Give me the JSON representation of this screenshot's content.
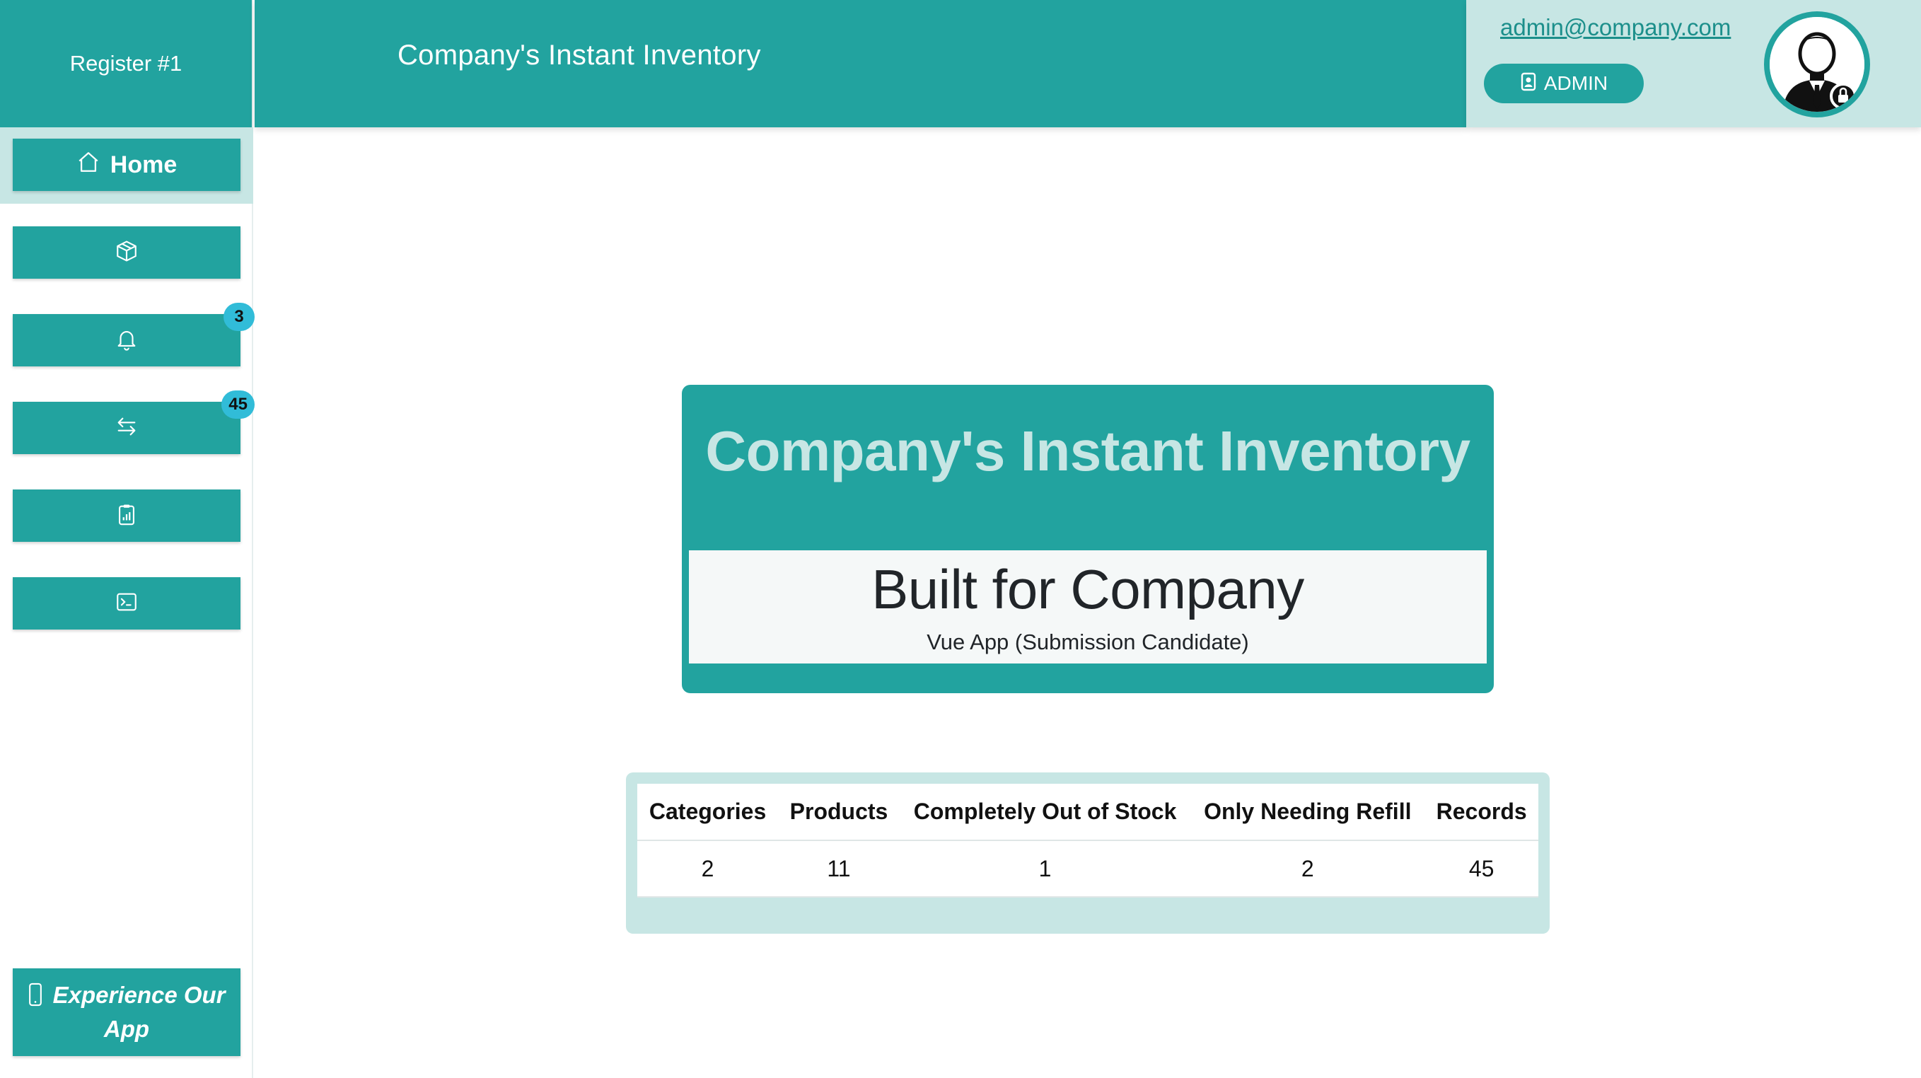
{
  "brand": {
    "register_label": "Register #1"
  },
  "header": {
    "title": "Company's Instant Inventory"
  },
  "user": {
    "email": "admin@company.com",
    "role": "ADMIN"
  },
  "sidebar": {
    "items": [
      {
        "label": "Home",
        "icon": "home-icon"
      },
      {
        "label": "",
        "icon": "box-icon"
      },
      {
        "label": "",
        "icon": "bell-icon",
        "badge": "3"
      },
      {
        "label": "",
        "icon": "transfer-arrows-icon",
        "badge": "45"
      },
      {
        "label": "",
        "icon": "report-clipboard-icon"
      },
      {
        "label": "",
        "icon": "terminal-icon"
      }
    ],
    "app_cta": {
      "label": "Experience Our App",
      "icon": "mobile-phone-icon"
    }
  },
  "hero": {
    "title": "Company's Instant Inventory",
    "subtitle": "Built for Company",
    "note": "Vue App (Submission Candidate)"
  },
  "stats": {
    "headers": [
      "Categories",
      "Products",
      "Completely Out of Stock",
      "Only Needing Refill",
      "Records"
    ],
    "values": [
      "2",
      "11",
      "1",
      "2",
      "45"
    ]
  },
  "colors": {
    "primary": "#22a39f",
    "primary_light": "#c7e6e4",
    "badge": "#31bcd8",
    "text_dark": "#212529"
  }
}
